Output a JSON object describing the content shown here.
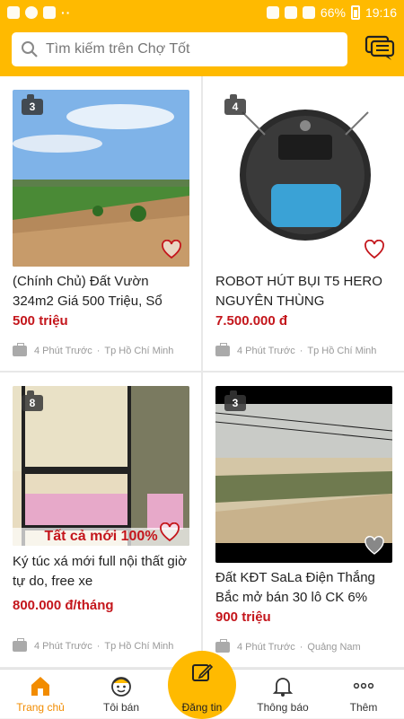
{
  "status_bar": {
    "battery": "66%",
    "time": "19:16"
  },
  "search": {
    "placeholder": "Tìm kiếm trên Chợ Tốt"
  },
  "listings": [
    {
      "photo_count": "3",
      "title": "(Chính Chủ) Đất Vườn 324m2 Giá 500 Triệu, Sổ",
      "price": "500 triệu",
      "time": "4 Phút Trước",
      "location": "Tp Hồ Chí Minh"
    },
    {
      "photo_count": "4",
      "title": "ROBOT HÚT BỤI T5 HERO NGUYÊN THÙNG",
      "price": "7.500.000 đ",
      "time": "4 Phút Trước",
      "location": "Tp Hồ Chí Minh"
    },
    {
      "photo_count": "8",
      "title": "Ký túc xá mới full nội thất giờ tự do, free xe",
      "price": "800.000 đ/tháng",
      "time": "4 Phút Trước",
      "location": "Tp Hồ Chí Minh",
      "banner": "Tất cả mới 100%"
    },
    {
      "photo_count": "3",
      "title": "Đất KĐT SaLa Điện Thắng Bắc mở bán 30 lô CK 6%",
      "price": "900 triệu",
      "time": "4 Phút Trước",
      "location": "Quảng Nam"
    }
  ],
  "tabs": [
    {
      "label": "Trang chủ",
      "icon": "home-icon",
      "active": true
    },
    {
      "label": "Tôi bán",
      "icon": "seller-face-icon"
    },
    {
      "label": "Đăng tin",
      "icon": "post-edit-icon"
    },
    {
      "label": "Thông báo",
      "icon": "bell-icon"
    },
    {
      "label": "Thêm",
      "icon": "more-icon"
    }
  ],
  "colors": {
    "brand": "#ffba00",
    "price": "#c4161c",
    "active_tab": "#f28c00"
  }
}
